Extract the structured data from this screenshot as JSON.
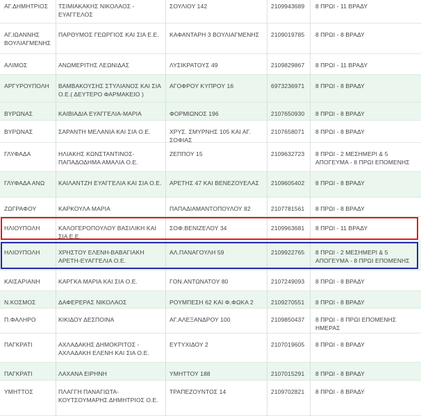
{
  "table": {
    "rows": [
      {
        "area": "ΑΓ.ΔΗΜΗΤΡΙΟΣ",
        "pharmacy": "ΤΣΙΜΙΑΚΑΚΗΣ ΝΙΚΟΛΑΟΣ - ΕΥΑΓΓΕΛΟΣ",
        "address": "ΣΟΥΛΙΟΥ 142",
        "phone": "2109943689",
        "hours": "8 ΠΡΩΙ - 11 ΒΡΑΔΥ"
      },
      {
        "area": "ΑΓ.ΙΩΑΝΝΗΣ ΒΟΥΛΙΑΓΜΕΝΗΣ",
        "pharmacy": "ΠΑΡΘΥΜΟΣ ΓΕΩΡΓΙΟΣ ΚΑΙ ΣΙΑ Ε.Ε.",
        "address": "ΚΑΦΑΝΤΑΡΗ 3 ΒΟΥΛΙΑΓΜΕΝΗΣ",
        "phone": "2109019785",
        "hours": "8 ΠΡΩΙ - 8 ΒΡΑΔΥ"
      },
      {
        "area": "ΑΛΙΜΟΣ",
        "pharmacy": "ΑΝΩΜΕΡΙΤΗΣ ΛΕΩΝΙΔΑΣ",
        "address": "ΛΥΣΙΚΡΑΤΟΥΣ 49",
        "phone": "2109829867",
        "hours": "8 ΠΡΩΙ - 11 ΒΡΑΔΥ"
      },
      {
        "area": "ΑΡΓΥΡΟΥΠΟΛΗ",
        "pharmacy": "ΒΑΜΒΑΚΟΥΣΗΣ ΣΤΥΛΙΑΝΟΣ ΚΑΙ ΣΙΑ Ο.Ε.( ΔΕΥΤΕΡΟ ΦΑΡΜΑΚΕΙΟ )",
        "address": "ΑΓΟΦΡΟΥ ΚΥΠΡΟΥ 16",
        "phone": "6973236971",
        "hours": "8 ΠΡΩΙ - 8 ΒΡΑΔΥ"
      },
      {
        "area": "ΒΥΡΩΝΑΣ",
        "pharmacy": "ΚΑΙΒΙΑΔΙΑ ΕΥΑΓΓΕΛΙΑ-ΜΑΡΙΑ",
        "address": "ΦΟΡΜΙΩΝΟΣ 196",
        "phone": "2107650930",
        "hours": "8 ΠΡΩΙ - 8 ΒΡΑΔΥ"
      },
      {
        "area": "ΒΥΡΩΝΑΣ",
        "pharmacy": "ΣΑΡΑΝΤΗ ΜΕΛΑΝΙΑ ΚΑΙ ΣΙΑ Ο.Ε.",
        "address": "ΧΡΥΣ. ΣΜΥΡΝΗΣ 105 ΚΑΙ ΑΓ. ΣΟΦΙΑΣ",
        "phone": "2107658071",
        "hours": "8 ΠΡΩΙ - 8 ΒΡΑΔΥ"
      },
      {
        "area": "ΓΛΥΦΑΔΑ",
        "pharmacy": "ΗΛΙΑΚΗΣ ΚΩΝΣΤΑΝΤΙΝΟΣ-ΠΑΠΑΔΟΔΗΜΑ ΑΜΑΛΙΑ Ο.Ε.",
        "address": "ΖΕΠΠΟΥ 15",
        "phone": "2109632723",
        "hours": "8 ΠΡΩΙ - 2 ΜΕΣΗΜΕΡΙ & 5 ΑΠΟΓΕΥΜΑ - 8 ΠΡΩΙ ΕΠΟΜΕΝΗΣ"
      },
      {
        "area": "ΓΛΥΦΑΔΑ ΑΝΩ",
        "pharmacy": "ΚΑΙΛΑΝΤΖΗ ΕΥΑΓΓΕΛΙΑ ΚΑΙ ΣΙΑ Ο.Ε.",
        "address": "ΑΡΕΤΗΣ 47 ΚΑΙ ΒΕΝΕΖΟΥΕΛΑΣ",
        "phone": "2109605402",
        "hours": "8 ΠΡΩΙ - 8 ΒΡΑΔΥ"
      },
      {
        "area": "ΖΩΓΡΑΦΟΥ",
        "pharmacy": "ΚΑΡΚΟΥΛΑ ΜΑΡΙΑ",
        "address": "ΠΑΠΑΔΙΑΜΑΝΤΟΠΟΥΛΟΥ 82",
        "phone": "2107781561",
        "hours": "8 ΠΡΩΙ - 8 ΒΡΑΔΥ"
      },
      {
        "area": "ΗΛΙΟΥΠΟΛΗ",
        "pharmacy": "ΚΑΛΟΓΕΡΟΠΟΥΛΟΥ ΒΑΣΙΛΙΚΗ ΚΑΙ ΣΙΑ Ε.Ε.",
        "address": "ΣΟΦ.ΒΕΝΙΖΕΛΟΥ 34",
        "phone": "2109963681",
        "hours": "8 ΠΡΩΙ - 11 ΒΡΑΔΥ"
      },
      {
        "area": "ΗΛΙΟΥΠΟΛΗ",
        "pharmacy": "ΧΡΗΣΤΟΥ ΕΛΕΝΗ-ΒΑΒΑΓΙΑΚΗ ΑΡΕΤΗ-ΕΥΑΓΓΕΛΙΑ Ο.Ε.",
        "address": "ΑΛ.ΠΑΝΑΓΟΥΛΗ 59",
        "phone": "2109922765",
        "hours": "8 ΠΡΩΙ - 2 ΜΕΣΗΜΕΡΙ & 5 ΑΠΟΓΕΥΜΑ - 8 ΠΡΩΙ ΕΠΟΜΕΝΗΣ"
      },
      {
        "area": "ΚΑΙΣΑΡΙΑΝΗ",
        "pharmacy": "ΚΑΡΓΚΑ ΜΑΡΙΑ ΚΑΙ ΣΙΑ Ο.Ε.",
        "address": "ΓΟΝ.ΑΝΤΩΝΑΤΟΥ 80",
        "phone": "2107249093",
        "hours": "8 ΠΡΩΙ - 8 ΒΡΑΔΥ"
      },
      {
        "area": "Ν.ΚΟΣΜΟΣ",
        "pharmacy": "ΔΑΦΕΡΕΡΑΣ ΝΙΚΟΛΑΟΣ",
        "address": "ΡΟΥΜΠΕΣΗ 62 ΚΑΙ Φ.ΦΩΚΑ 2",
        "phone": "2109270551",
        "hours": "8 ΠΡΩΙ - 8 ΒΡΑΔΥ"
      },
      {
        "area": "Π.ΦΑΛΗΡΟ",
        "pharmacy": "ΚΙΚΙΔΟΥ ΔΕΣΠΟΙΝΑ",
        "address": "ΑΓ.ΑΛΕΞΑΝΔΡΟΥ 100",
        "phone": "2109850437",
        "hours": "8 ΠΡΩΙ - 8 ΠΡΩΙ ΕΠΟΜΕΝΗΣ ΗΜΕΡΑΣ"
      },
      {
        "area": "ΠΑΓΚΡΑΤΙ",
        "pharmacy": "ΑΧΛΑΔΑΚΗΣ ΔΗΜΟΚΡΙΤΟΣ - ΑΧΛΑΔΑΚΗ ΕΛΕΝΗ ΚΑΙ ΣΙΑ Ο.Ε.",
        "address": "ΕΥΤΥΧΙΔΟΥ 2",
        "phone": "2107019605",
        "hours": "8 ΠΡΩΙ - 8 ΒΡΑΔΥ"
      },
      {
        "area": "ΠΑΓΚΡΑΤΙ",
        "pharmacy": "ΛΑΧΑΝΑ ΕΙΡΗΝΗ",
        "address": "ΥΜΗΤΤΟΥ 188",
        "phone": "2107015291",
        "hours": "8 ΠΡΩΙ - 8 ΒΡΑΔΥ"
      },
      {
        "area": "ΥΜΗΤΤΟΣ",
        "pharmacy": "ΠΛΑΓΓΗ ΠΑΝΑΓΙΩΤΑ-ΚΟΥΤΣΟΥΜΑΡΗΣ ΔΗΜΗΤΡΙΟΣ Ο.Ε.",
        "address": "ΤΡΑΠΕΖΟΥΝΤΟΣ 14",
        "phone": "2109702821",
        "hours": "8 ΠΡΩΙ - 8 ΒΡΑΔΥ"
      }
    ]
  }
}
